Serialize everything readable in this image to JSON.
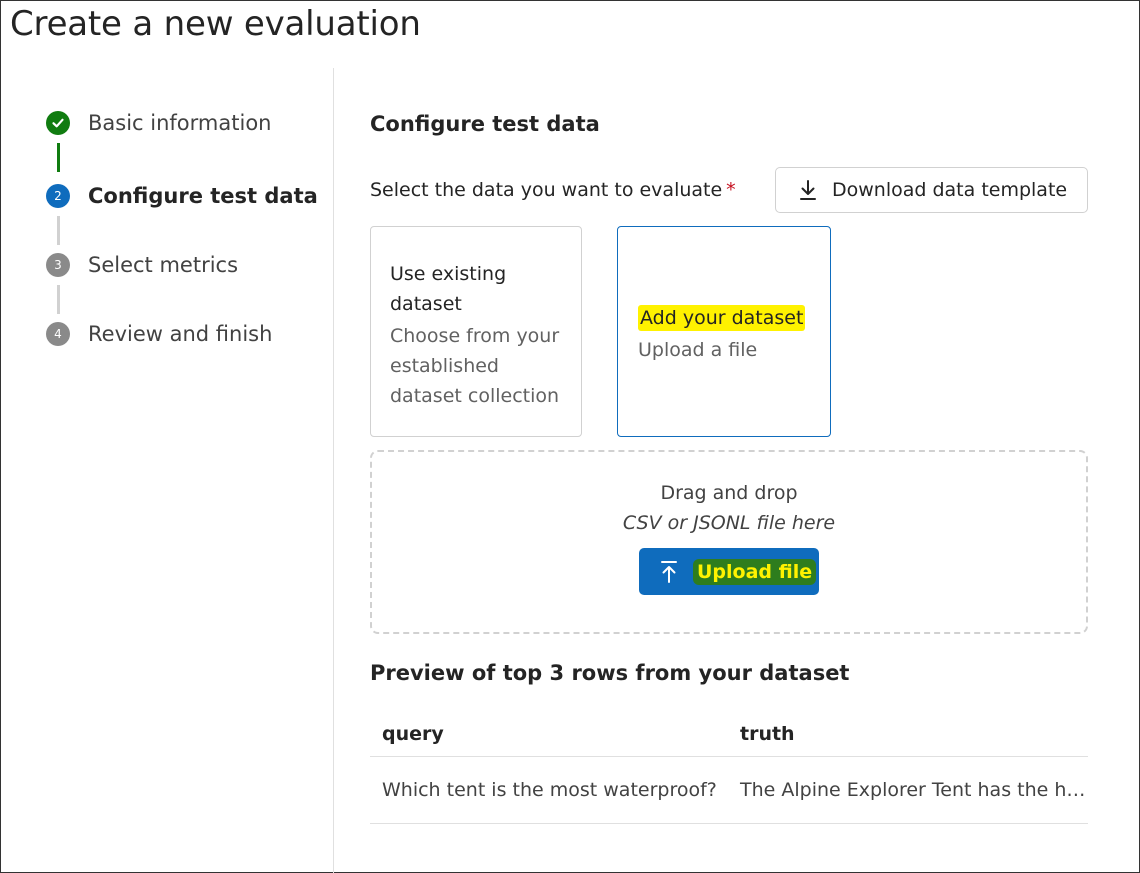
{
  "page": {
    "title": "Create a new evaluation"
  },
  "stepper": {
    "steps": [
      {
        "number": "",
        "label": "Basic information",
        "state": "done"
      },
      {
        "number": "2",
        "label": "Configure test data",
        "state": "active"
      },
      {
        "number": "3",
        "label": "Select metrics",
        "state": "pending"
      },
      {
        "number": "4",
        "label": "Review and finish",
        "state": "pending"
      }
    ]
  },
  "main": {
    "section_title": "Configure test data",
    "field_label": "Select the data you want to evaluate",
    "required_marker": "*",
    "download_button": {
      "label": "Download data template",
      "icon": "download-icon"
    },
    "cards": [
      {
        "title_line1": "Use existing",
        "title_line2": "dataset",
        "desc_line1": "Choose from your",
        "desc_line2": "established",
        "desc_line3": "dataset collection",
        "selected": false
      },
      {
        "title": "Add your dataset",
        "desc": "Upload a file",
        "selected": true
      }
    ],
    "dropzone": {
      "line1": "Drag and drop",
      "line2": "CSV or JSONL file here",
      "upload_button": {
        "label": "Upload file",
        "icon": "upload-icon"
      }
    },
    "preview": {
      "title": "Preview of top 3 rows from your dataset",
      "columns": [
        "query",
        "truth"
      ],
      "rows": [
        [
          "Which tent is the most waterproof?",
          "The Alpine Explorer Tent has the h…"
        ]
      ]
    }
  },
  "colors": {
    "accent": "#0f6cbd",
    "success": "#107c10",
    "required": "#c50f1f",
    "highlight_yellow": "#fff200",
    "highlight_green": "#2e7d1d"
  }
}
